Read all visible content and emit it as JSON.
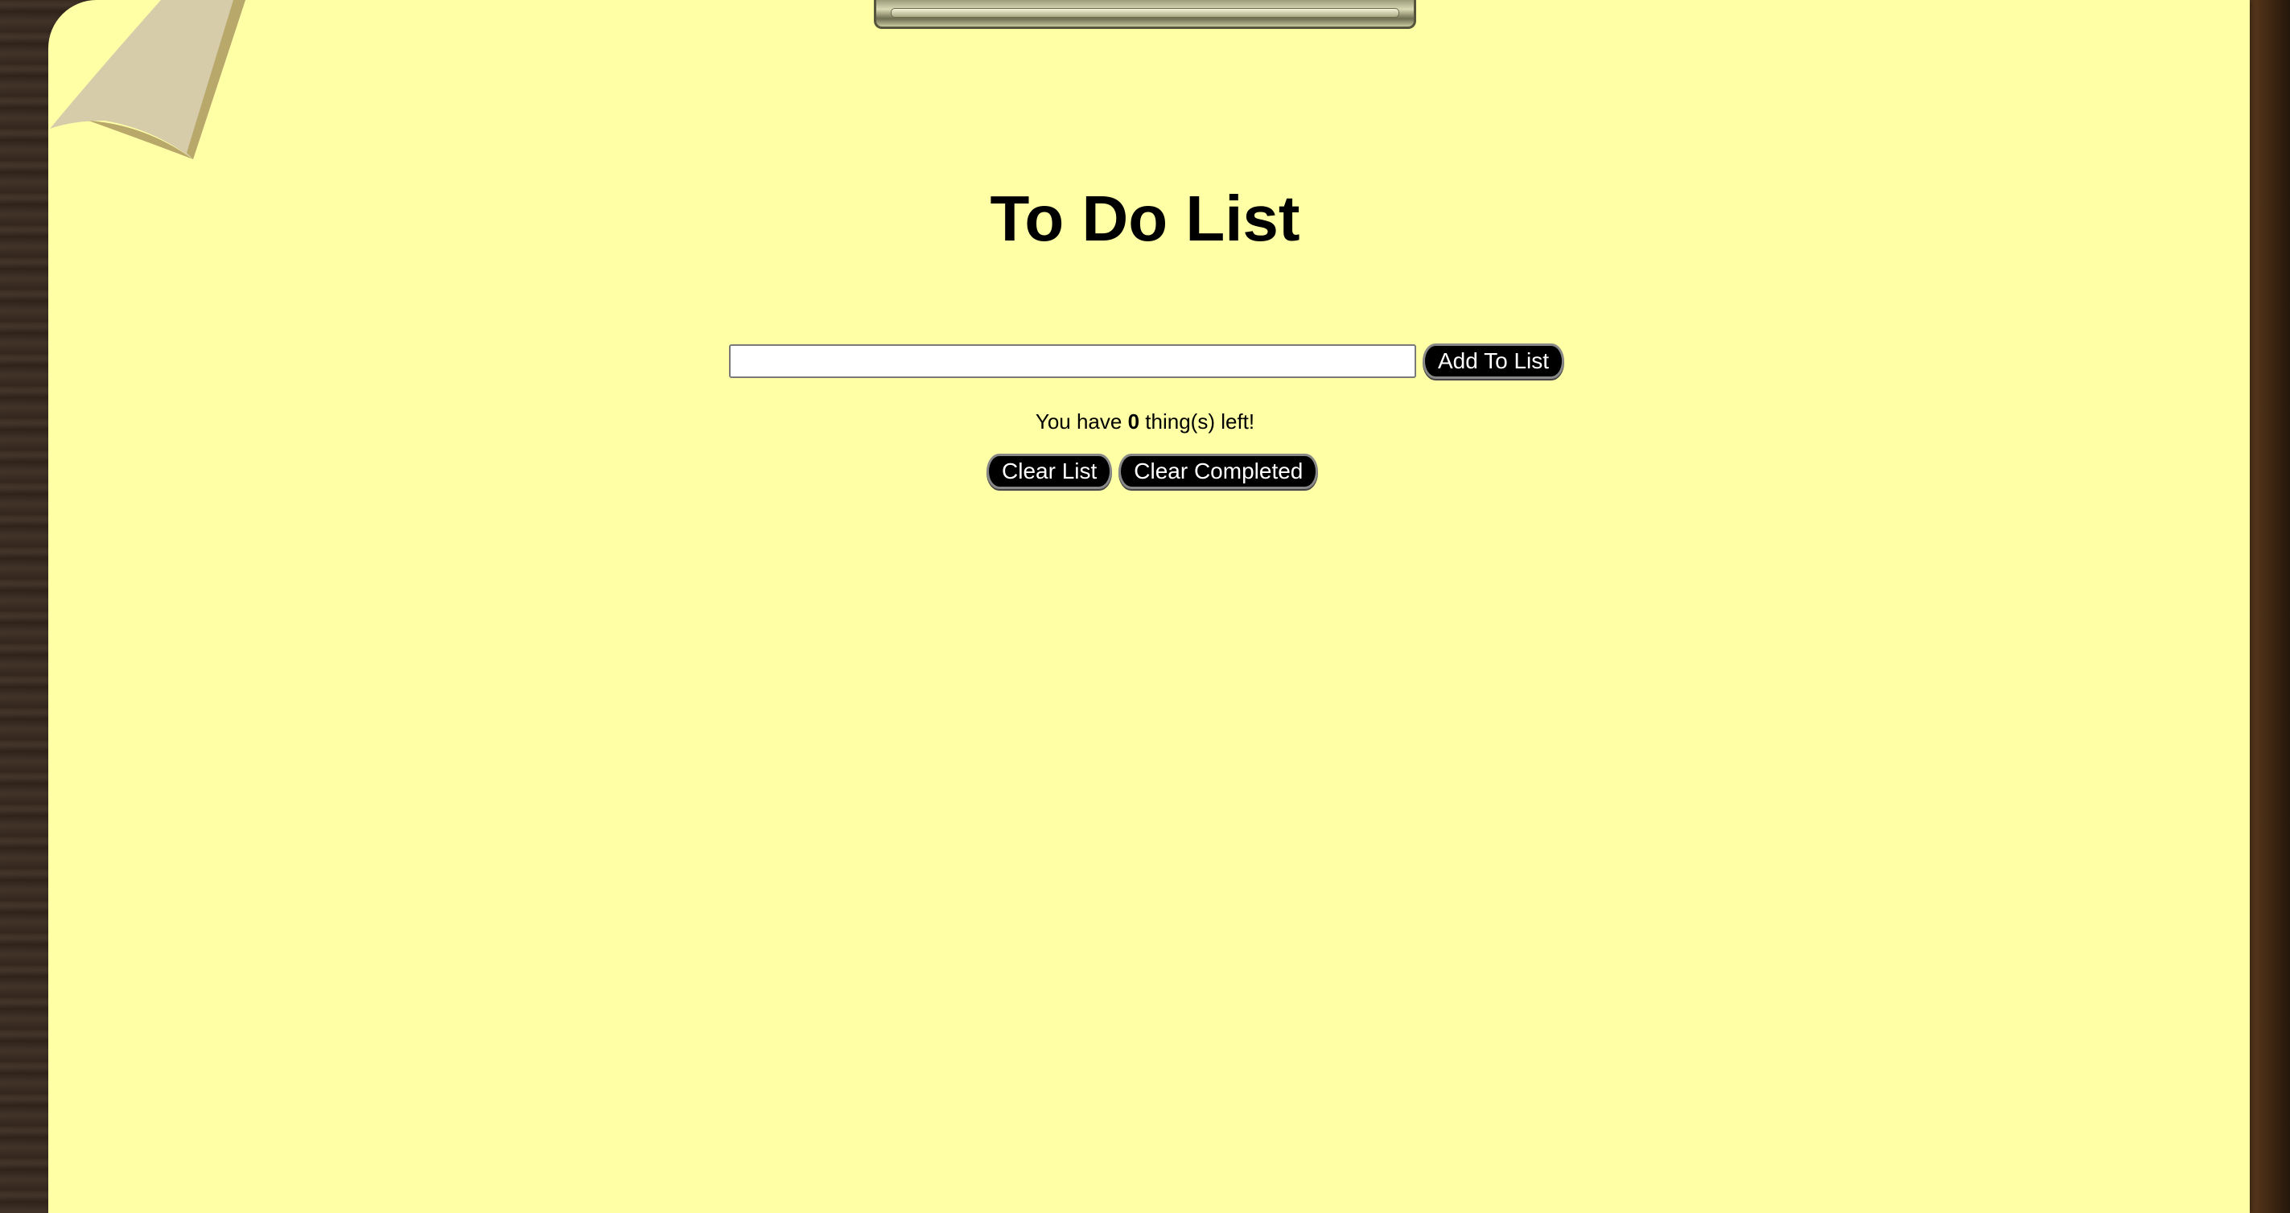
{
  "page": {
    "title": "To Do List"
  },
  "add_form": {
    "input_value": "",
    "input_placeholder": "",
    "add_button_label": "Add To List"
  },
  "status": {
    "prefix": "You have",
    "count": "0",
    "suffix": "thing(s) left!"
  },
  "actions": {
    "clear_list_label": "Clear List",
    "clear_completed_label": "Clear Completed"
  },
  "colors": {
    "paper": "#ffffa5",
    "wood": "#2e2219",
    "button_bg": "#000000",
    "button_text": "#ffffff"
  }
}
